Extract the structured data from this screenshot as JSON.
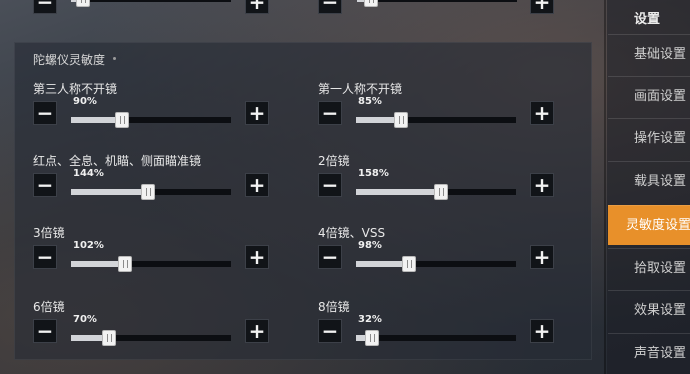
{
  "section": {
    "title": "陀螺仪灵敏度"
  },
  "controls": {
    "minus_glyph": "−",
    "plus_glyph": "+"
  },
  "settings": [
    {
      "label": "第三人称不开镜",
      "value": "90%",
      "fraction": 0.32
    },
    {
      "label": "第一人称不开镜",
      "value": "85%",
      "fraction": 0.28
    },
    {
      "label": "红点、全息、机瞄、侧面瞄准镜",
      "value": "144%",
      "fraction": 0.48
    },
    {
      "label": "2倍镜",
      "value": "158%",
      "fraction": 0.53
    },
    {
      "label": "3倍镜",
      "value": "102%",
      "fraction": 0.34
    },
    {
      "label": "4倍镜、VSS",
      "value": "98%",
      "fraction": 0.33
    },
    {
      "label": "6倍镜",
      "value": "70%",
      "fraction": 0.24
    },
    {
      "label": "8倍镜",
      "value": "32%",
      "fraction": 0.1
    }
  ],
  "sidebar": {
    "title": "设置",
    "items": [
      {
        "label": "基础设置",
        "active": false
      },
      {
        "label": "画面设置",
        "active": false
      },
      {
        "label": "操作设置",
        "active": false
      },
      {
        "label": "载具设置",
        "active": false
      },
      {
        "label": "灵敏度设置",
        "active": true
      },
      {
        "label": "拾取设置",
        "active": false
      },
      {
        "label": "效果设置",
        "active": false
      },
      {
        "label": "声音设置",
        "active": false
      }
    ]
  },
  "colors": {
    "accent": "#e8902a"
  }
}
